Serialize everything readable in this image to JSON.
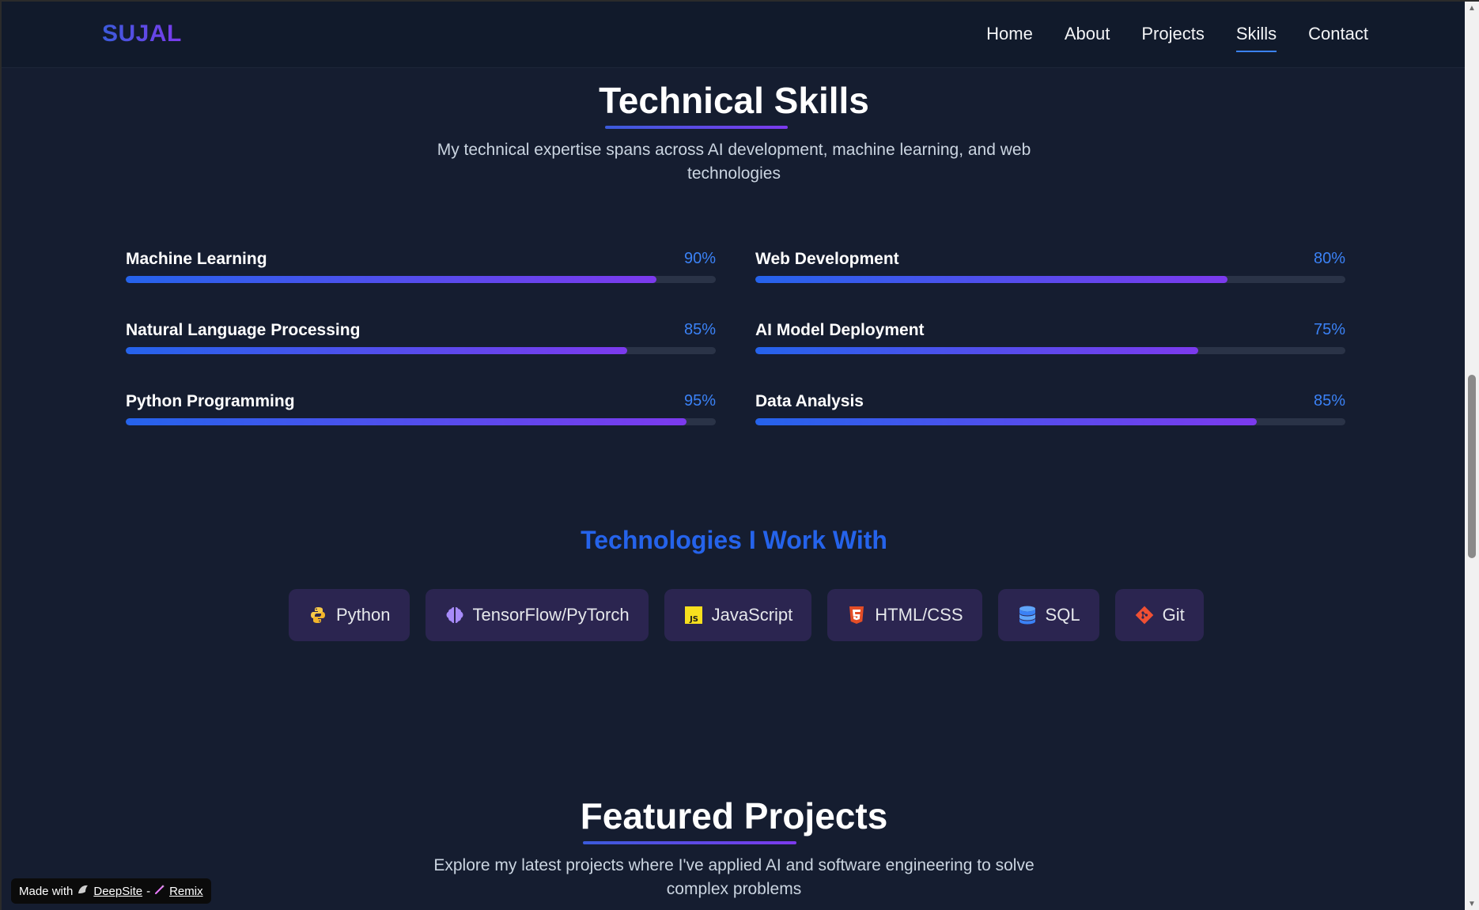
{
  "nav": {
    "logo": "SUJAL",
    "links": [
      "Home",
      "About",
      "Projects",
      "Skills",
      "Contact"
    ],
    "active": "Skills"
  },
  "skills_section": {
    "title": "Technical Skills",
    "subtitle_line1": "My technical expertise spans across AI development, machine learning, and web",
    "subtitle_line2": "technologies",
    "skills": [
      {
        "name": "Machine Learning",
        "percent_label": "90%",
        "level": 0.9
      },
      {
        "name": "Web Development",
        "percent_label": "80%",
        "level": 0.8
      },
      {
        "name": "Natural Language Processing",
        "percent_label": "85%",
        "level": 0.85
      },
      {
        "name": "AI Model Deployment",
        "percent_label": "75%",
        "level": 0.75
      },
      {
        "name": "Python Programming",
        "percent_label": "95%",
        "level": 0.95
      },
      {
        "name": "Data Analysis",
        "percent_label": "85%",
        "level": 0.85
      }
    ]
  },
  "technologies": {
    "title": "Technologies I Work With",
    "items": [
      {
        "label": "Python",
        "icon": "python-icon"
      },
      {
        "label": "TensorFlow/PyTorch",
        "icon": "brain-icon"
      },
      {
        "label": "JavaScript",
        "icon": "javascript-icon"
      },
      {
        "label": "HTML/CSS",
        "icon": "html5-icon"
      },
      {
        "label": "SQL",
        "icon": "database-icon"
      },
      {
        "label": "Git",
        "icon": "git-icon"
      }
    ]
  },
  "projects_section": {
    "title": "Featured Projects",
    "subtitle_line1": "Explore my latest projects where I've applied AI and software engineering to solve",
    "subtitle_line2": "complex problems"
  },
  "badge": {
    "prefix": "Made with",
    "link1": "DeepSite",
    "separator": "-",
    "link2": "Remix"
  },
  "colors": {
    "accent_blue": "#2563eb",
    "accent_purple": "#7c3aed",
    "background": "#151d30",
    "chip_background": "#2b2550"
  }
}
